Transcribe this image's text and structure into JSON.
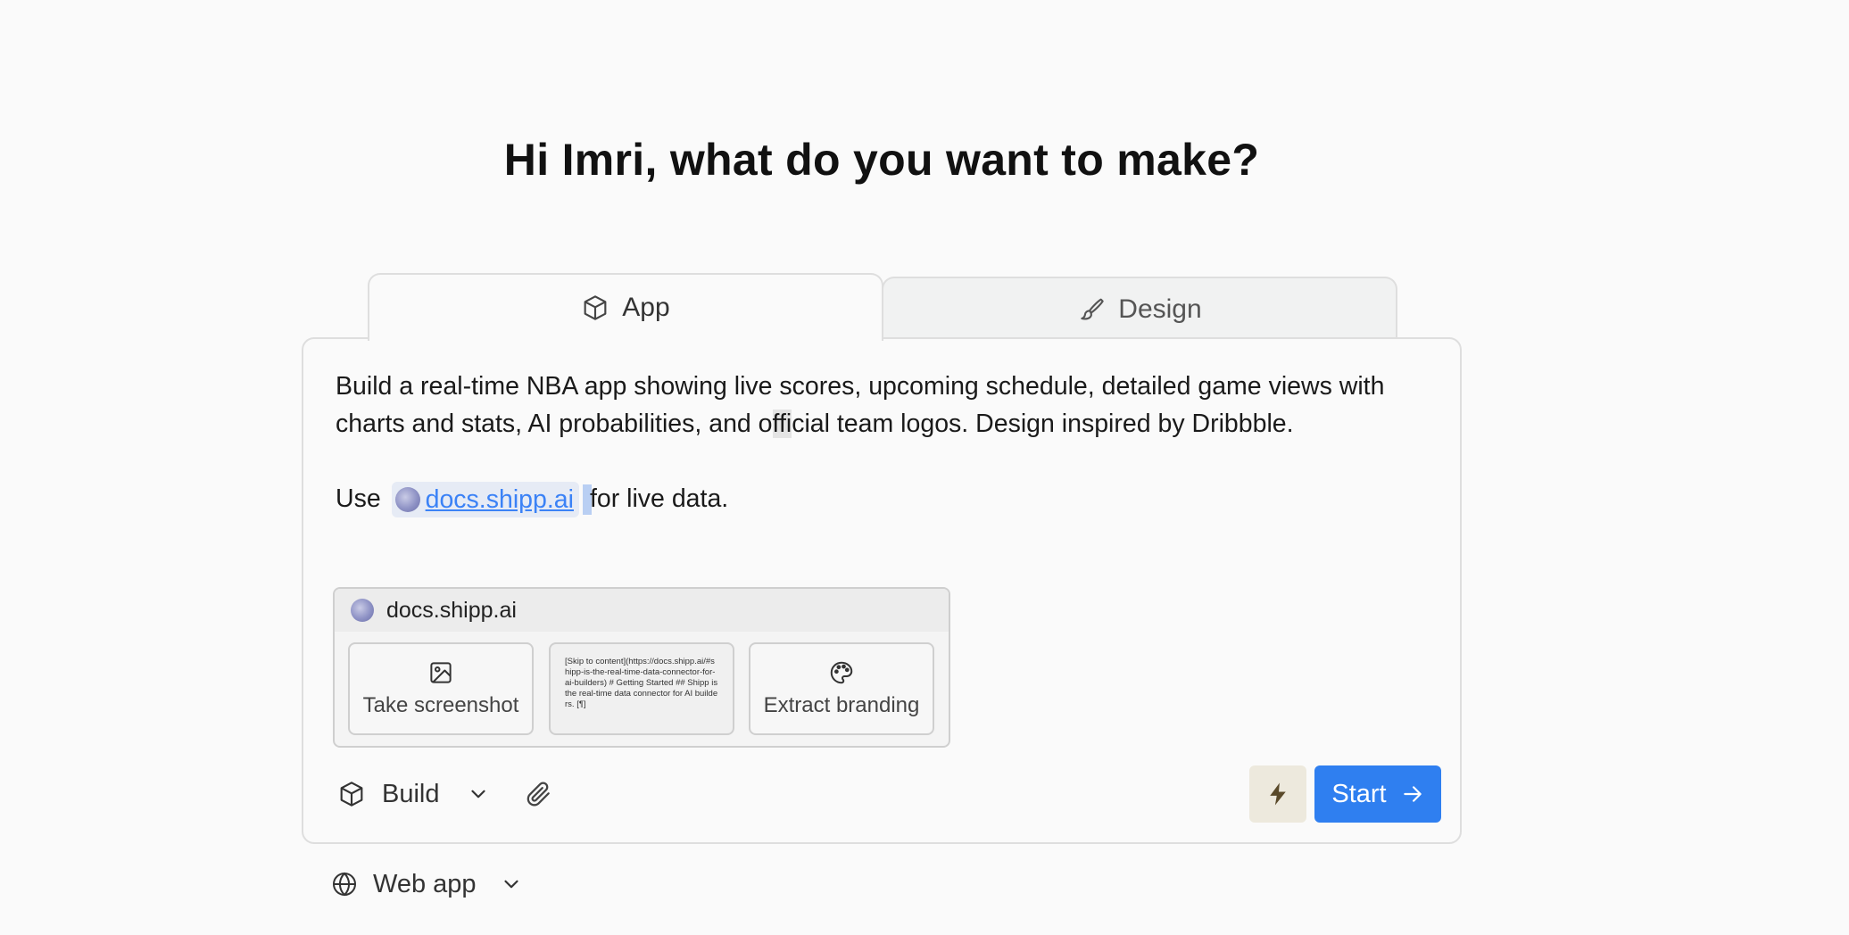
{
  "heading": "Hi Imri, what do you want to make?",
  "tabs": [
    {
      "label": "App",
      "icon": "cube-icon",
      "active": true
    },
    {
      "label": "Design",
      "icon": "paintbrush-icon",
      "active": false
    }
  ],
  "prompt": {
    "line1_a": "Build a real-time NBA app showing live scores, upcoming schedule, detailed game views with",
    "line2_a": "charts and stats, AI probabilities, and o",
    "line2_hl": "ffi",
    "line2_b": "cial team logos. Design inspired by Dribbble.",
    "line3_prefix": "Use",
    "mention_link": "docs.shipp.ai",
    "line3_suffix": "for live data."
  },
  "link_preview": {
    "domain": "docs.shipp.ai",
    "actions": {
      "screenshot_label": "Take screenshot",
      "branding_label": "Extract branding"
    },
    "snippet": "[Skip to content](https://docs.shipp.ai/#shipp-is-the-real-time-data-connector-for-ai-builders) # Getting Started ## Shipp is the real-time data connector for AI builders. [¶]"
  },
  "toolbar": {
    "mode_label": "Build",
    "start_label": "Start"
  },
  "platform": {
    "label": "Web app"
  },
  "colors": {
    "accent": "#2f7ff0",
    "bolt_bg": "#ede9dd",
    "link": "#3b82f6",
    "chip_bg": "#e6ebf5"
  }
}
